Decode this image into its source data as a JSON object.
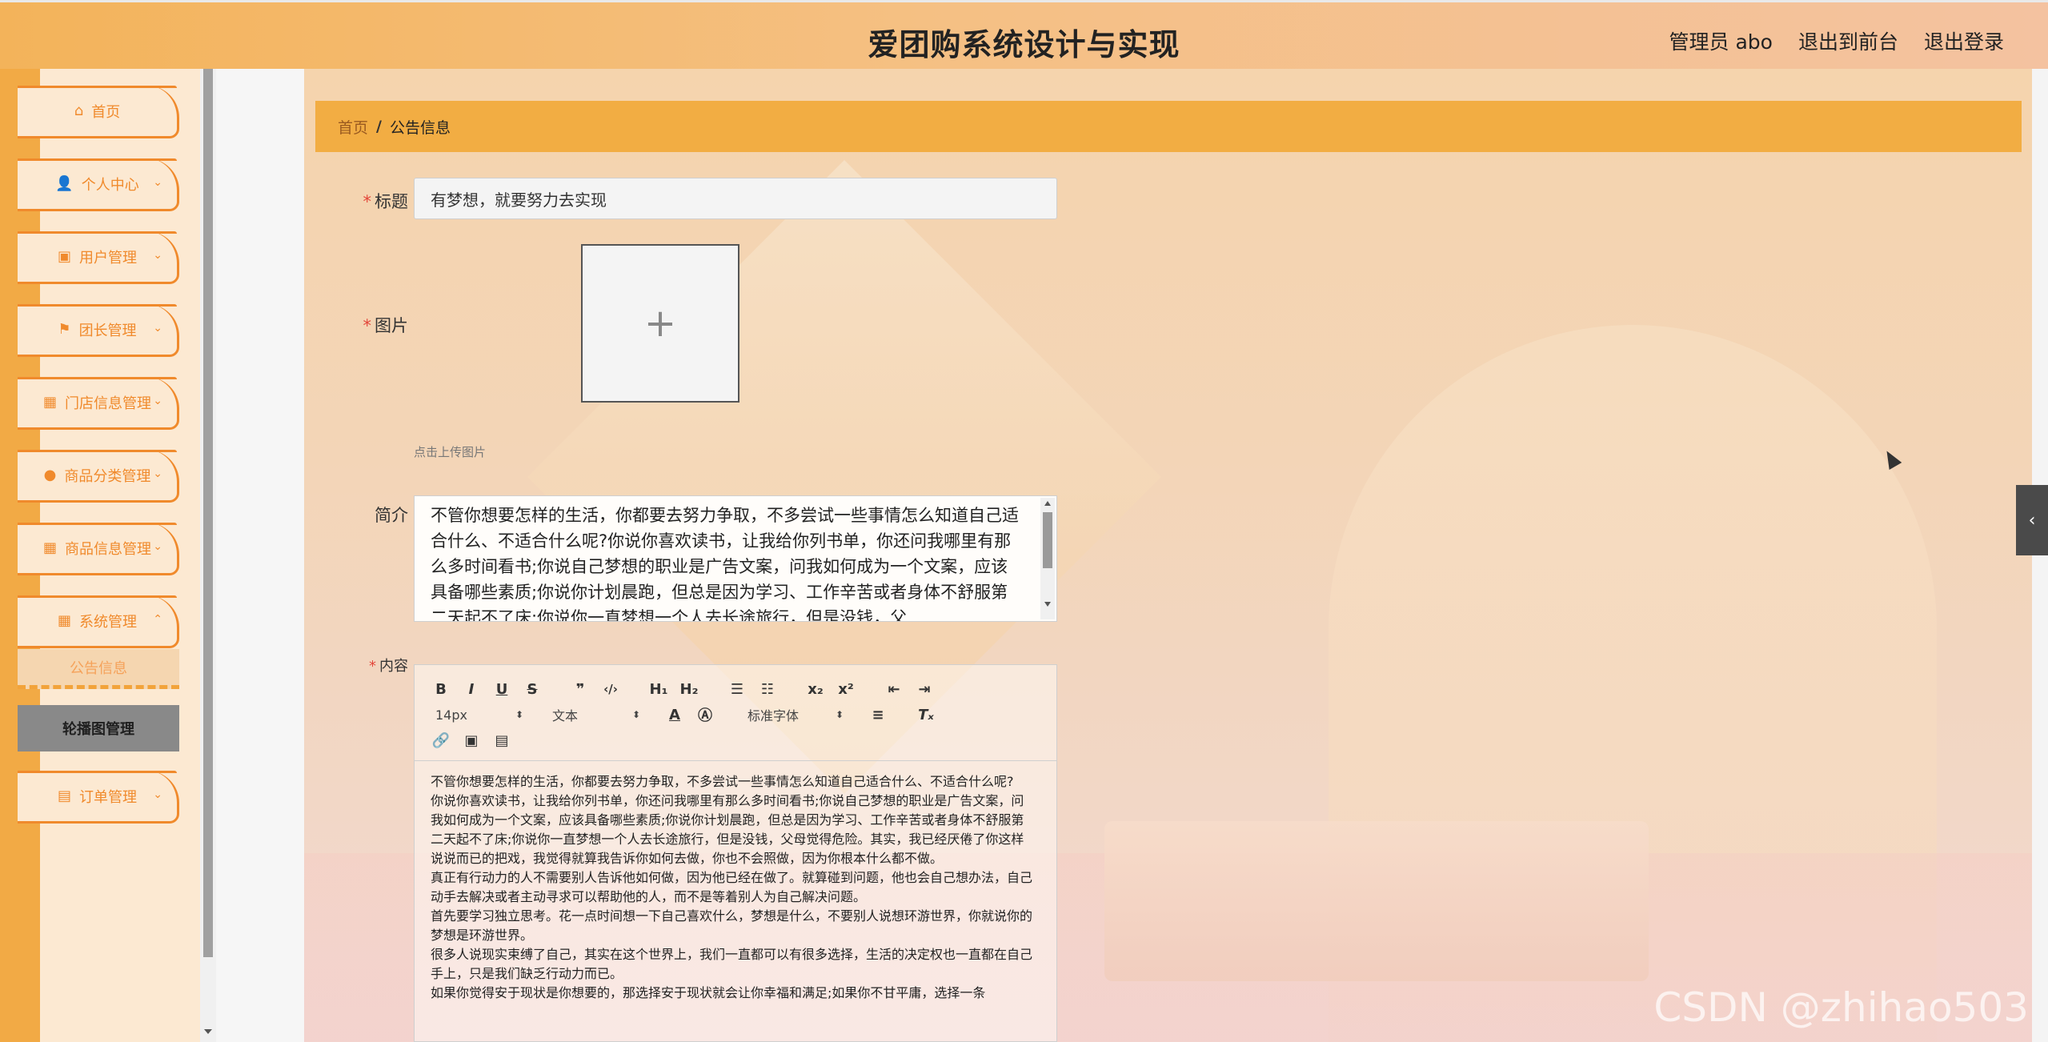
{
  "header": {
    "title": "爱团购系统设计与实现",
    "admin_label": "管理员 abo",
    "to_front_label": "退出到前台",
    "logout_label": "退出登录"
  },
  "sidebar": {
    "items": [
      {
        "label": "首页",
        "icon": "home-icon"
      },
      {
        "label": "个人中心",
        "icon": "user-icon"
      },
      {
        "label": "用户管理",
        "icon": "clipboard-icon"
      },
      {
        "label": "团长管理",
        "icon": "flag-icon"
      },
      {
        "label": "门店信息管理",
        "icon": "grid-icon"
      },
      {
        "label": "商品分类管理",
        "icon": "location-pin-icon"
      },
      {
        "label": "商品信息管理",
        "icon": "grid-icon"
      },
      {
        "label": "系统管理",
        "icon": "grid-icon"
      }
    ],
    "sub_items": [
      "公告信息",
      "轮播图管理"
    ],
    "order_item": {
      "label": "订单管理",
      "icon": "briefcase-icon"
    }
  },
  "breadcrumb": {
    "home": "首页",
    "separator": "/",
    "current": "公告信息"
  },
  "form": {
    "title_label": "标题",
    "title_value": "有梦想，就要努力去实现",
    "image_label": "图片",
    "upload_tip": "点击上传图片",
    "intro_label": "简介",
    "intro_text": "不管你想要怎样的生活，你都要去努力争取，不多尝试一些事情怎么知道自己适合什么、不适合什么呢?你说你喜欢读书，让我给你列书单，你还问我哪里有那么多时间看书;你说自己梦想的职业是广告文案，问我如何成为一个文案，应该具备哪些素质;你说你计划晨跑，但总是因为学习、工作辛苦或者身体不舒服第二天起不了床;你说你一直梦想一个人去长途旅行，但是没钱，父",
    "content_label": "内容"
  },
  "editor": {
    "font_size": "14px",
    "block_type": "文本",
    "font_family": "标准字体",
    "paragraphs": [
      "不管你想要怎样的生活，你都要去努力争取，不多尝试一些事情怎么知道自己适合什么、不适合什么呢?",
      "你说你喜欢读书，让我给你列书单，你还问我哪里有那么多时间看书;你说自己梦想的职业是广告文案，问我如何成为一个文案，应该具备哪些素质;你说你计划晨跑，但总是因为学习、工作辛苦或者身体不舒服第二天起不了床;你说你一直梦想一个人去长途旅行，但是没钱，父母觉得危险。其实，我已经厌倦了你这样说说而已的把戏，我觉得就算我告诉你如何去做，你也不会照做，因为你根本什么都不做。",
      "真正有行动力的人不需要别人告诉他如何做，因为他已经在做了。就算碰到问题，他也会自己想办法，自己动手去解决或者主动寻求可以帮助他的人，而不是等着别人为自己解决问题。",
      "首先要学习独立思考。花一点时间想一下自己喜欢什么，梦想是什么，不要别人说想环游世界，你就说你的梦想是环游世界。",
      "很多人说现实束缚了自己，其实在这个世界上，我们一直都可以有很多选择，生活的决定权也一直都在自己手上，只是我们缺乏行动力而已。",
      "如果你觉得安于现状是你想要的，那选择安于现状就会让你幸福和满足;如果你不甘平庸，选择一条"
    ]
  },
  "watermark": "CSDN @zhihao503"
}
